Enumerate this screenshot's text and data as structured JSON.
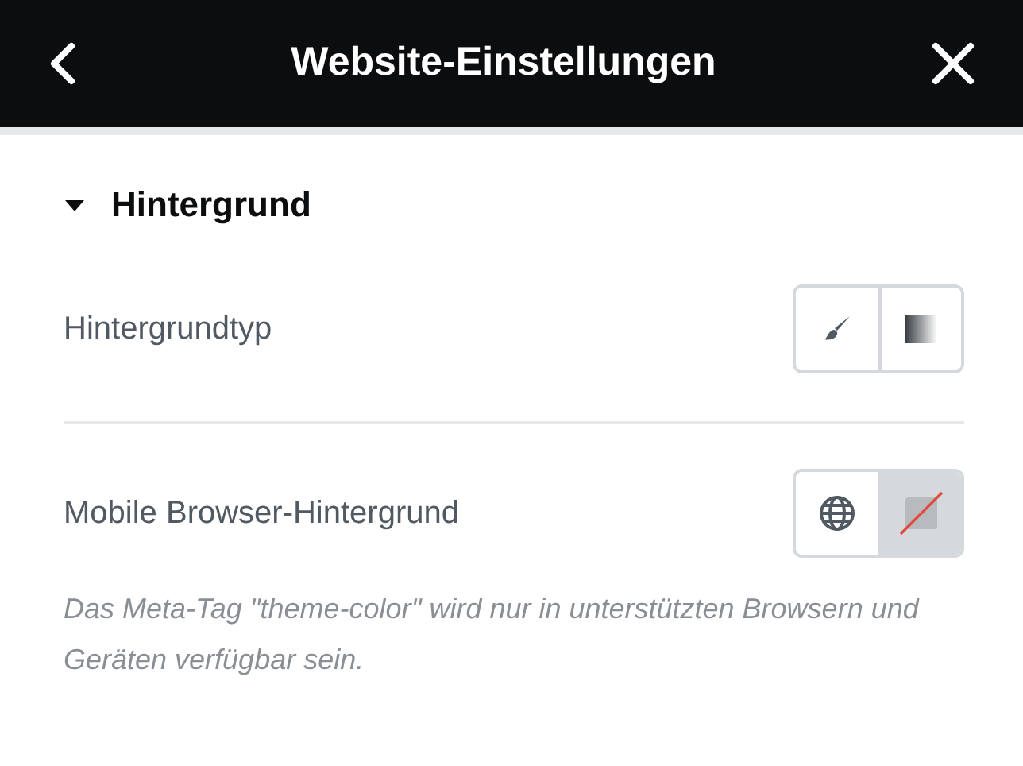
{
  "header": {
    "title": "Website-Einstellungen"
  },
  "section": {
    "title": "Hintergrund",
    "expanded": true
  },
  "controls": [
    {
      "label": "Hintergrundtyp",
      "options": [
        {
          "kind": "brush",
          "selected": false
        },
        {
          "kind": "gradient",
          "selected": false
        }
      ]
    },
    {
      "label": "Mobile Browser-Hintergrund",
      "options": [
        {
          "kind": "globe",
          "selected": false
        },
        {
          "kind": "none",
          "selected": true
        }
      ],
      "help": "Das Meta-Tag \"theme-color\" wird nur in unterstützten Browsern und Geräten verfügbar sein."
    }
  ]
}
